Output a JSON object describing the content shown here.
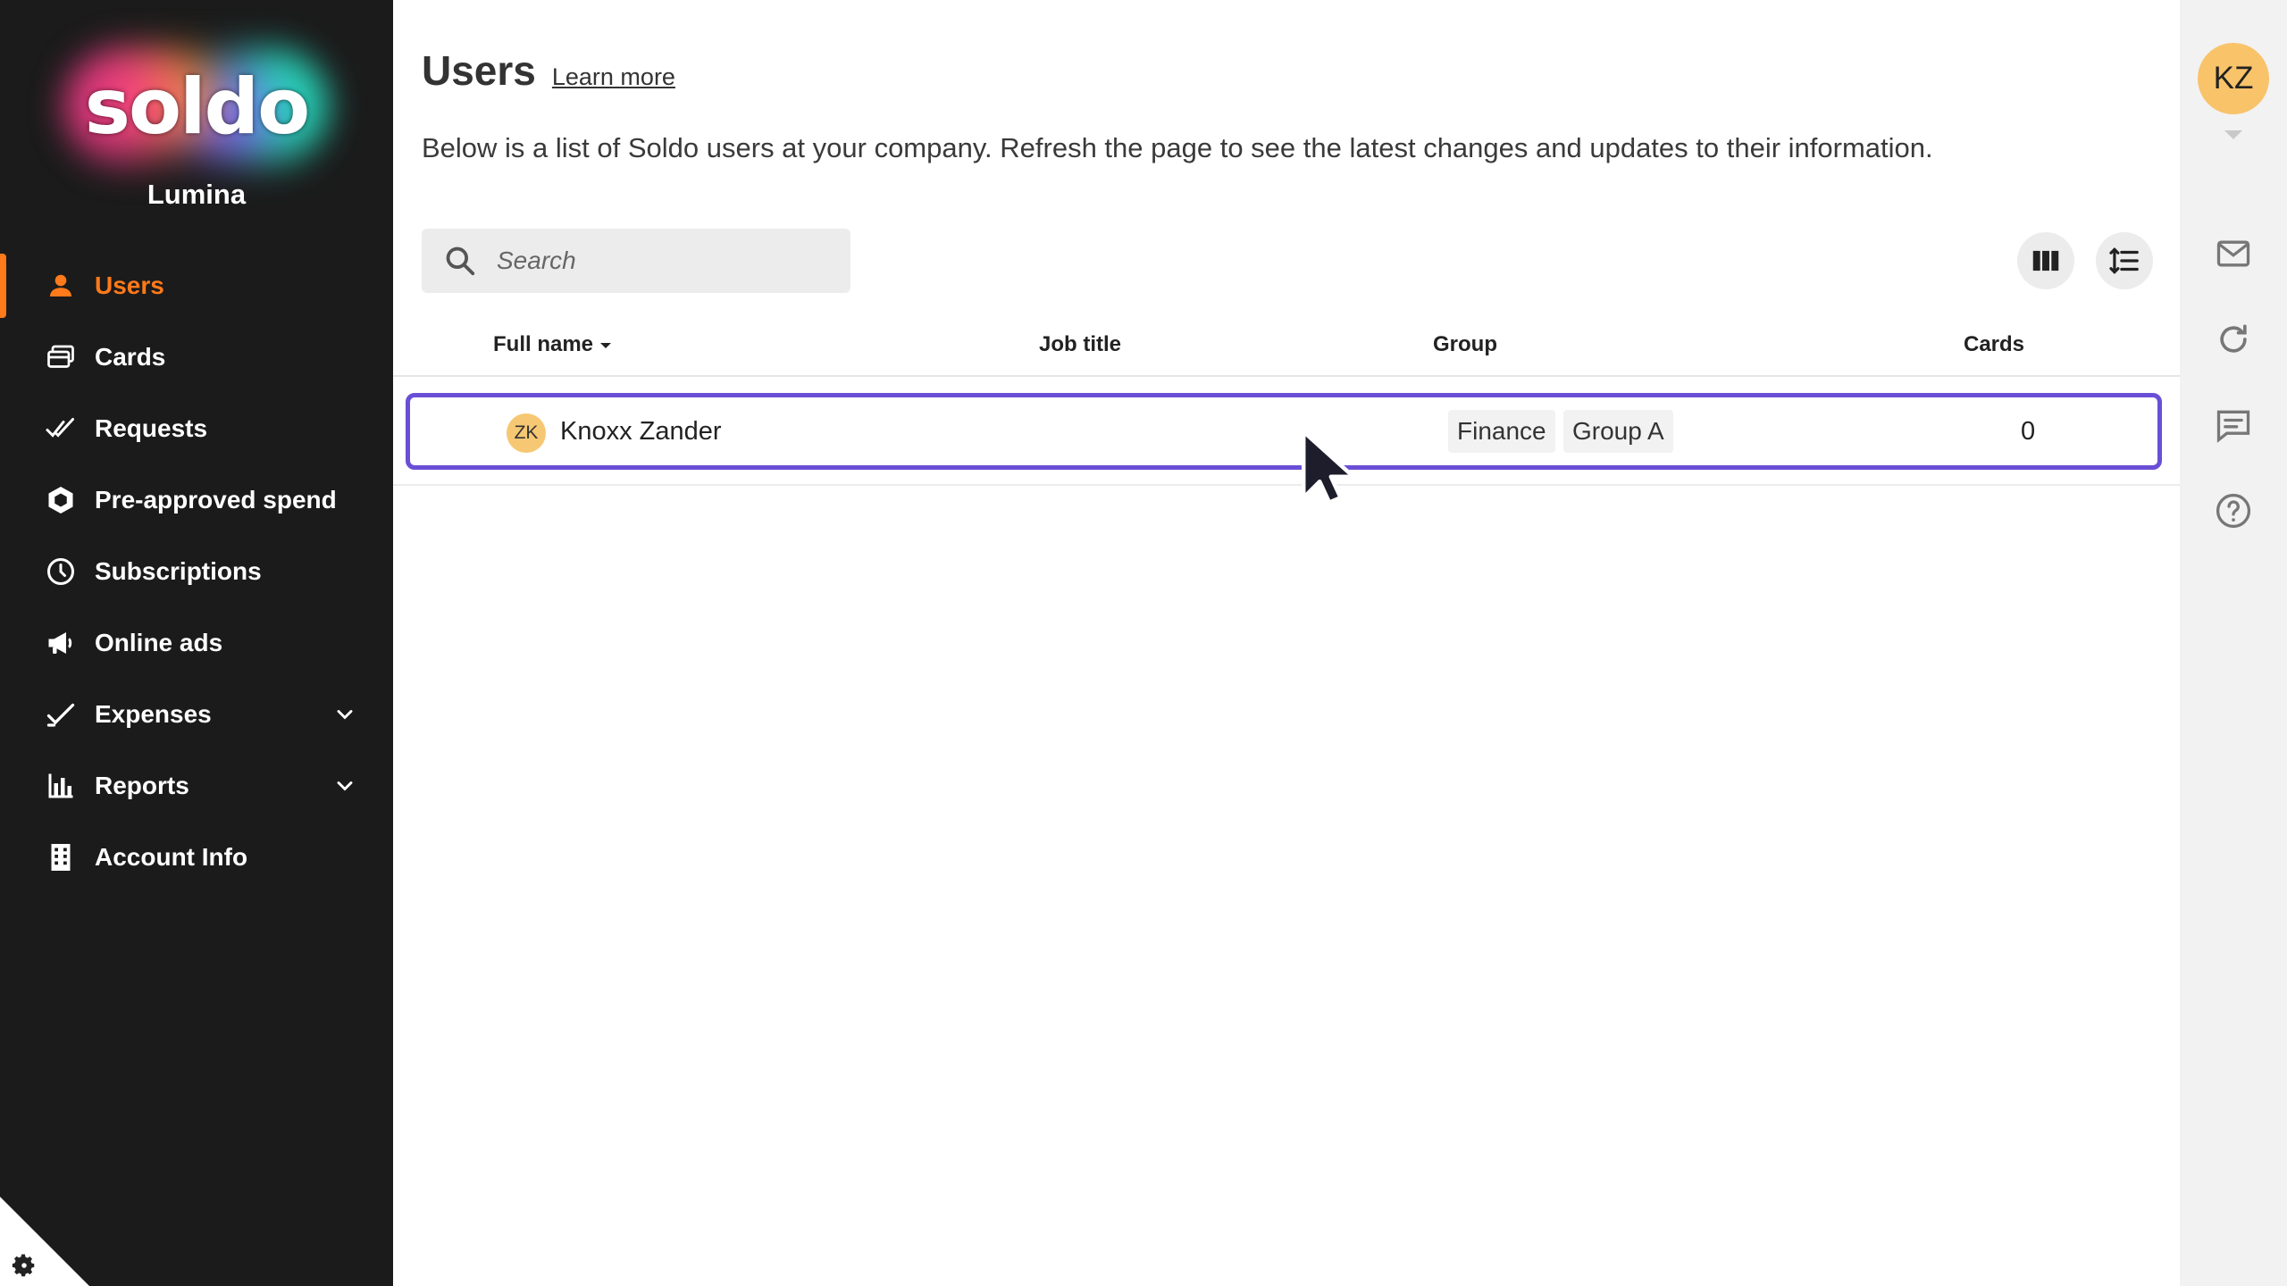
{
  "sidebar": {
    "logo_text": "soldo",
    "company": "Lumina",
    "items": [
      {
        "label": "Users",
        "icon": "user-icon",
        "active": true
      },
      {
        "label": "Cards",
        "icon": "cards-icon"
      },
      {
        "label": "Requests",
        "icon": "double-check-icon"
      },
      {
        "label": "Pre-approved spend",
        "icon": "hexagon-icon"
      },
      {
        "label": "Subscriptions",
        "icon": "clock-icon"
      },
      {
        "label": "Online ads",
        "icon": "megaphone-icon"
      },
      {
        "label": "Expenses",
        "icon": "checkmark-icon",
        "expandable": true
      },
      {
        "label": "Reports",
        "icon": "bar-chart-icon",
        "expandable": true
      },
      {
        "label": "Account Info",
        "icon": "building-icon"
      }
    ]
  },
  "page": {
    "title": "Users",
    "learn_more": "Learn more",
    "description": "Below is a list of Soldo users at your company. Refresh the page to see the latest changes and updates to their information."
  },
  "search": {
    "placeholder": "Search",
    "value": ""
  },
  "table": {
    "columns": {
      "full_name": "Full name",
      "job_title": "Job title",
      "group": "Group",
      "cards": "Cards"
    },
    "rows": [
      {
        "initials": "ZK",
        "name": "Knoxx Zander",
        "job_title": "",
        "groups": [
          "Finance",
          "Group A"
        ],
        "cards": "0"
      }
    ]
  },
  "rail": {
    "avatar_initials": "KZ",
    "icons": [
      "mail-icon",
      "refresh-icon",
      "chat-icon",
      "help-icon"
    ]
  },
  "colors": {
    "sidebar_bg": "#1b1b1b",
    "accent": "#ff7a1a",
    "row_highlight": "#6a4fd6",
    "avatar": "#f9c36a"
  }
}
